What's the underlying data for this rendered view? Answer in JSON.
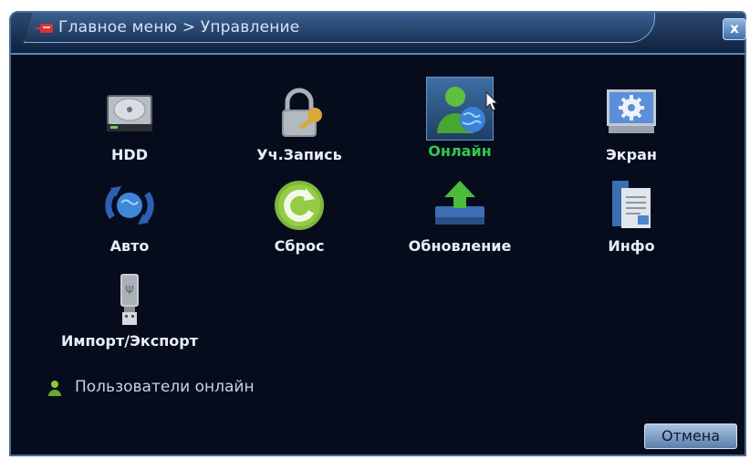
{
  "window": {
    "title": "Главное меню > Управление",
    "close_label": "x"
  },
  "tiles": [
    {
      "label": "HDD",
      "icon": "hdd-icon"
    },
    {
      "label": "Уч.Запись",
      "icon": "lock-key-icon"
    },
    {
      "label": "Онлайн",
      "icon": "online-user-globe-icon",
      "selected": true
    },
    {
      "label": "Экран",
      "icon": "screen-gear-icon"
    },
    {
      "label": "Авто",
      "icon": "auto-globe-arrows-icon"
    },
    {
      "label": "Сброс",
      "icon": "reset-icon"
    },
    {
      "label": "Обновление",
      "icon": "upgrade-arrow-icon"
    },
    {
      "label": "Инфо",
      "icon": "info-document-icon"
    },
    {
      "label": "Импорт/Экспорт",
      "icon": "usb-drive-icon"
    }
  ],
  "users_online": {
    "label": "Пользователи онлайн",
    "icon": "user-icon"
  },
  "buttons": {
    "cancel": "Отмена"
  },
  "colors": {
    "background": "#070c1d",
    "selected_label": "#35c552",
    "label": "#e8eef7",
    "title_bar": "#2d4a72"
  }
}
